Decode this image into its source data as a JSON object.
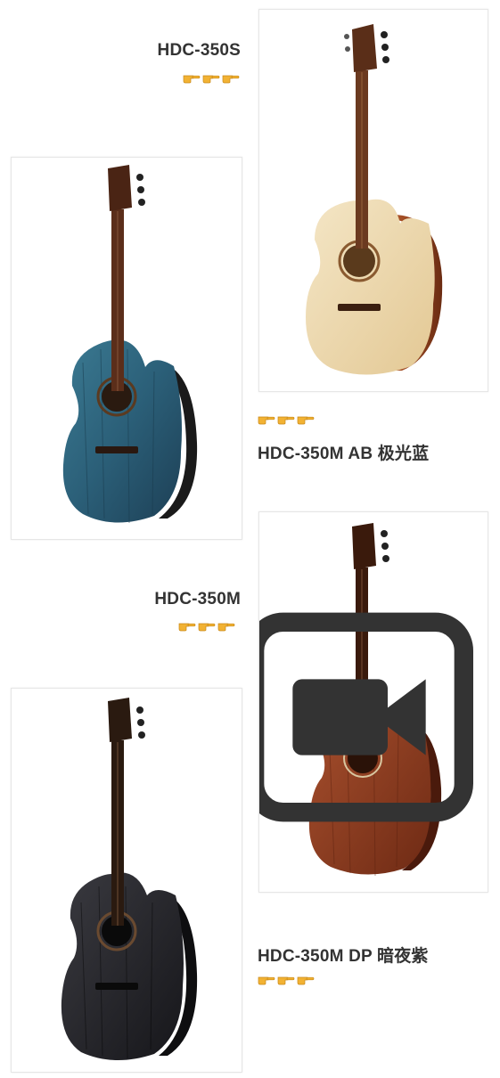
{
  "products": [
    {
      "id": "hdc-350s",
      "title": "HDC-350S",
      "pointer_count": 3,
      "finish": "natural spruce"
    },
    {
      "id": "hdc-350m-ab",
      "title": "HDC-350M AB 极光蓝",
      "pointer_count": 3,
      "finish": "blue"
    },
    {
      "id": "hdc-350m",
      "title": "HDC-350M",
      "pointer_count": 3,
      "finish": "mahogany"
    },
    {
      "id": "hdc-350m-dp",
      "title": "HDC-350M DP 暗夜紫",
      "pointer_count": 3,
      "finish": "black"
    }
  ],
  "icons": {
    "pointer": "pointing-hand-icon",
    "video": "video-icon"
  },
  "colors": {
    "title_text": "#333333",
    "card_border": "#e6e6e6",
    "hand": "#f2b233"
  }
}
